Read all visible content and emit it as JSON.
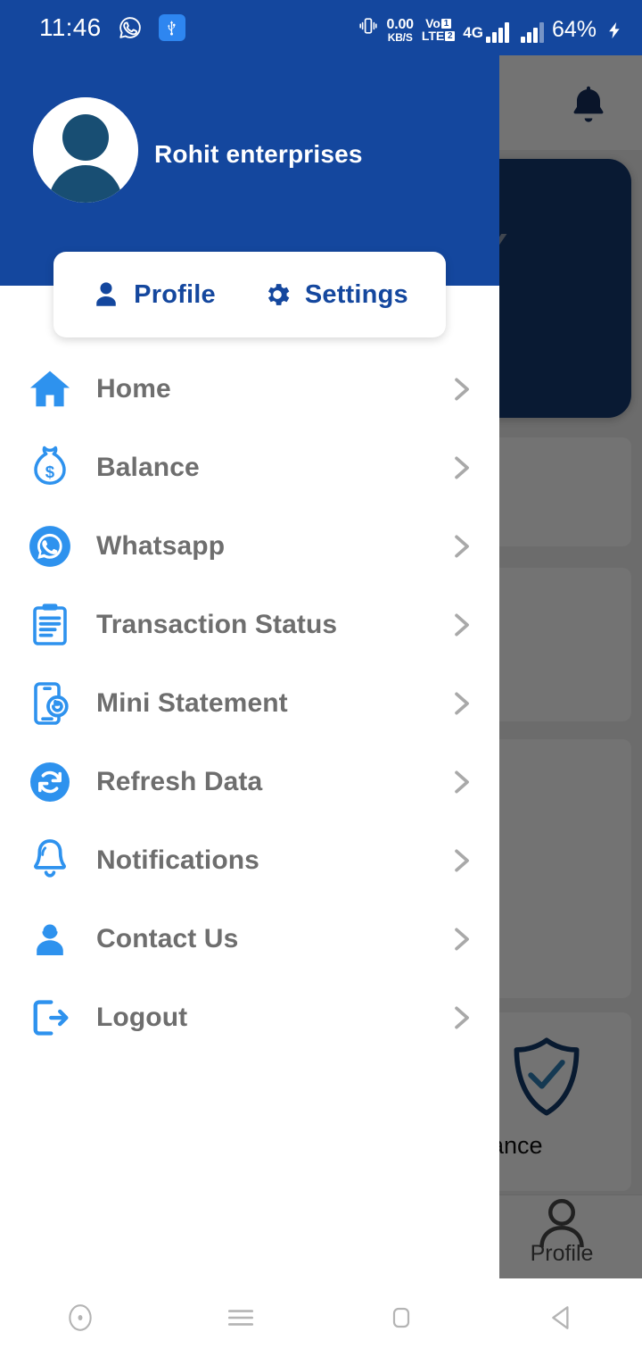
{
  "status_bar": {
    "time": "11:46",
    "whatsapp_icon": "whatsapp-icon",
    "usb_icon": "usb-icon",
    "vibrate_icon": "vibrate-icon",
    "data_rate_value": "0.00",
    "data_rate_unit": "KB/S",
    "volte_vo": "Vo",
    "volte_lte": "LTE",
    "volte_sim_top": "1",
    "volte_sim_bottom": "2",
    "network_type": "4G",
    "battery_percent": "64%",
    "charging_icon": "lightning-bolt-icon"
  },
  "drawer": {
    "avatar_icon": "user-avatar-icon",
    "account_name": "Rohit enterprises",
    "quick_actions": [
      {
        "label": "Profile",
        "icon": "person-icon"
      },
      {
        "label": "Settings",
        "icon": "gear-icon"
      }
    ],
    "menu_items": [
      {
        "label": "Home",
        "icon": "home-icon",
        "chevron": "chevron-right-icon"
      },
      {
        "label": "Balance",
        "icon": "money-bag-icon",
        "chevron": "chevron-right-icon"
      },
      {
        "label": "Whatsapp",
        "icon": "whatsapp-icon",
        "chevron": "chevron-right-icon"
      },
      {
        "label": "Transaction Status",
        "icon": "clipboard-list-icon",
        "chevron": "chevron-right-icon"
      },
      {
        "label": "Mini Statement",
        "icon": "mobile-statement-icon",
        "chevron": "chevron-right-icon"
      },
      {
        "label": "Refresh Data",
        "icon": "refresh-icon",
        "chevron": "chevron-right-icon"
      },
      {
        "label": "Notifications",
        "icon": "bell-icon",
        "chevron": "chevron-right-icon"
      },
      {
        "label": "Contact Us",
        "icon": "headset-support-icon",
        "chevron": "chevron-right-icon"
      },
      {
        "label": "Logout",
        "icon": "logout-icon",
        "chevron": "chevron-right-icon"
      }
    ]
  },
  "background_app": {
    "notification_bell_icon": "bell-icon",
    "insurance_tile_label": "Insurance",
    "insurance_tile_icon": "shield-check-icon",
    "bottom_nav_profile_label": "Profile",
    "bottom_nav_profile_icon": "person-outline-icon"
  },
  "android_nav": {
    "buttons": [
      {
        "name": "assistant-button",
        "icon": "circle-dot-icon"
      },
      {
        "name": "recents-button",
        "icon": "hamburger-icon"
      },
      {
        "name": "home-button",
        "icon": "square-icon"
      },
      {
        "name": "back-button",
        "icon": "triangle-left-icon"
      }
    ]
  },
  "colors": {
    "brand_blue": "#14479e",
    "icon_blue": "#2e92ee",
    "menu_text": "#6e6e6e",
    "chevron_grey": "#a9a9a9",
    "card_white": "#ffffff"
  }
}
